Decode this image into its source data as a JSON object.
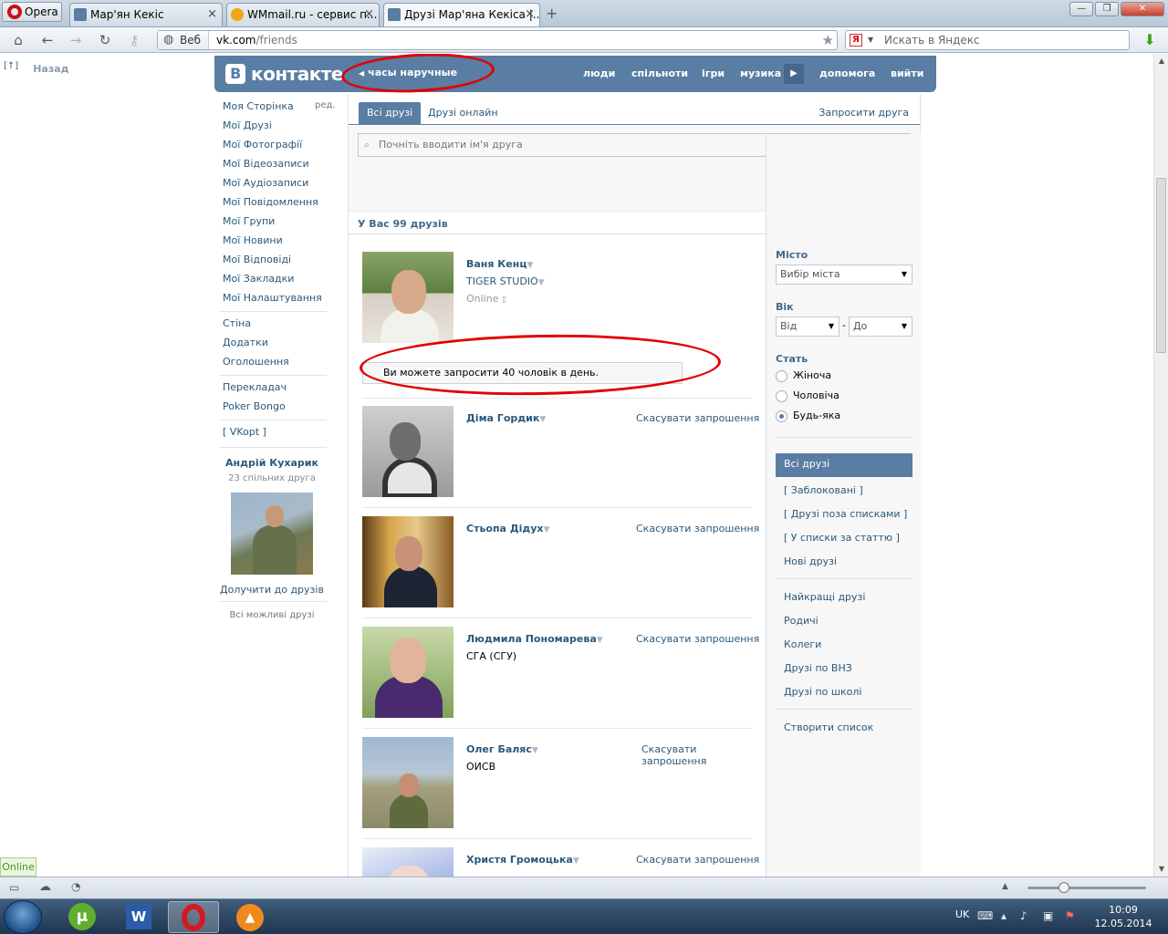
{
  "browser": {
    "menu_label": "Opera",
    "tabs": [
      {
        "label": "Мар'ян Кекіс"
      },
      {
        "label": "WMmail.ru - сервис п..."
      },
      {
        "label": "Друзі Мар'яна Кекіса |..."
      }
    ],
    "address_mode": "Веб",
    "url_host": "vk.com",
    "url_path": "/friends",
    "search_placeholder": "Искать в Яндекс",
    "search_engine_letter": "Я"
  },
  "page": {
    "back_link": "Назад",
    "back_marker": "[↑]",
    "header": {
      "logo_letter": "В",
      "logo_text": "контакте",
      "status_text": "часы наручные",
      "nav": [
        "люди",
        "спільноти",
        "ігри",
        "музика",
        "допомога",
        "вийти"
      ]
    },
    "left_menu": {
      "edit_label": "ред.",
      "items": [
        "Моя Сторінка",
        "Мої Друзі",
        "Мої Фотографії",
        "Мої Відеозаписи",
        "Мої Аудіозаписи",
        "Мої Повідомлення",
        "Мої Групи",
        "Мої Новини",
        "Мої Відповіді",
        "Мої Закладки",
        "Мої Налаштування"
      ],
      "extra": [
        "Стіна",
        "Додатки",
        "Оголошення"
      ],
      "apps": [
        "Перекладач",
        "Poker Bongo"
      ],
      "vkopt": "[ VKopt ]",
      "suggestion": {
        "name": "Андрій Кухарик",
        "mutual": "23 спільних друга",
        "add_label": "Долучити до друзів",
        "all_label": "Всі можливі друзі"
      }
    },
    "tabs": {
      "all": "Всі друзі",
      "online": "Друзі онлайн",
      "invite": "Запросити друга"
    },
    "search_placeholder": "Почніть вводити ім'я друга",
    "friends_count": "У Вас 99 друзів",
    "notice": "Ви можете запросити 40 чоловік в день.",
    "friends": [
      {
        "name": "Ваня Кенц",
        "sub": "TIGER STUDIO",
        "status": "Online",
        "action": ""
      },
      {
        "name": "Діма Гордик",
        "sub": "",
        "status": "",
        "action": "Скасувати запрошення"
      },
      {
        "name": "Стьопа Дідух",
        "sub": "",
        "status": "",
        "action": "Скасувати запрошення"
      },
      {
        "name": "Людмила Пономарева",
        "sub": "СГА (СГУ)",
        "status": "",
        "action": "Скасувати запрошення"
      },
      {
        "name": "Олег Баляс",
        "sub": "ОИСВ",
        "status": "",
        "action": "Скасувати запрошення"
      },
      {
        "name": "Христя Громоцька",
        "sub": "",
        "status": "",
        "action": "Скасувати запрошення"
      }
    ],
    "filter": {
      "city_label": "Місто",
      "city_value": "Вибір міста",
      "age_label": "Вік",
      "age_from": "Від",
      "age_dash": "-",
      "age_to": "До",
      "sex_label": "Стать",
      "sex_options": [
        "Жіноча",
        "Чоловіча",
        "Будь-яка"
      ],
      "sex_selected": "Будь-яка",
      "lists": [
        "Всі друзі",
        "[ Заблоковані ]",
        "[ Друзі поза списками ]",
        "[ У списки за статтю ]",
        "Нові друзі"
      ],
      "categories": [
        "Найкращі друзі",
        "Родичі",
        "Колеги",
        "Друзі по ВНЗ",
        "Друзі по школі"
      ],
      "create_list": "Створити список"
    }
  },
  "status": {
    "online_badge": "Online"
  },
  "taskbar": {
    "lang": "UK",
    "time": "10:09",
    "date": "12.05.2014"
  },
  "colors": {
    "vk_blue": "#597da3",
    "link": "#2b587a",
    "annotation_red": "#e10000"
  }
}
